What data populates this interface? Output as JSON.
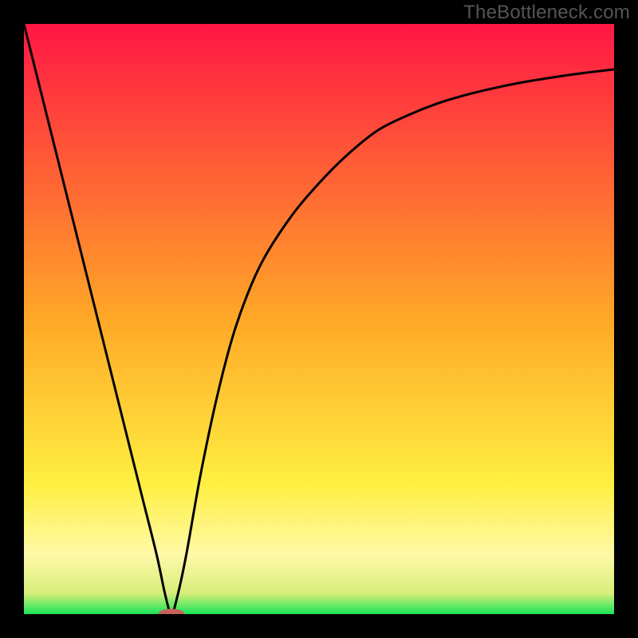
{
  "attribution": "TheBottleneck.com",
  "chart_data": {
    "type": "line",
    "title": "",
    "xlabel": "",
    "ylabel": "",
    "xlim": [
      0,
      100
    ],
    "ylim": [
      0,
      100
    ],
    "gradient_stops": [
      {
        "offset": 0.0,
        "color": "#ff1744"
      },
      {
        "offset": 0.5,
        "color": "#ffa827"
      },
      {
        "offset": 0.78,
        "color": "#ffef41"
      },
      {
        "offset": 0.9,
        "color": "#fff9a8"
      },
      {
        "offset": 0.965,
        "color": "#d6ee7a"
      },
      {
        "offset": 1.0,
        "color": "#18e457"
      }
    ],
    "series": [
      {
        "name": "bottleneck-curve",
        "x": [
          0,
          5,
          10,
          15,
          20,
          22.5,
          24,
          25,
          26,
          27.5,
          30,
          33,
          36,
          40,
          45,
          50,
          55,
          60,
          65,
          70,
          75,
          80,
          85,
          90,
          95,
          100
        ],
        "y": [
          100,
          80,
          60,
          40,
          20,
          10,
          3,
          0,
          3,
          10,
          24,
          38,
          49,
          59,
          67,
          73,
          78,
          82,
          84.5,
          86.5,
          88,
          89.2,
          90.2,
          91,
          91.7,
          92.3
        ]
      }
    ],
    "marker": {
      "x": 25,
      "y": 0,
      "rx": 2.2,
      "ry": 0.9
    }
  }
}
